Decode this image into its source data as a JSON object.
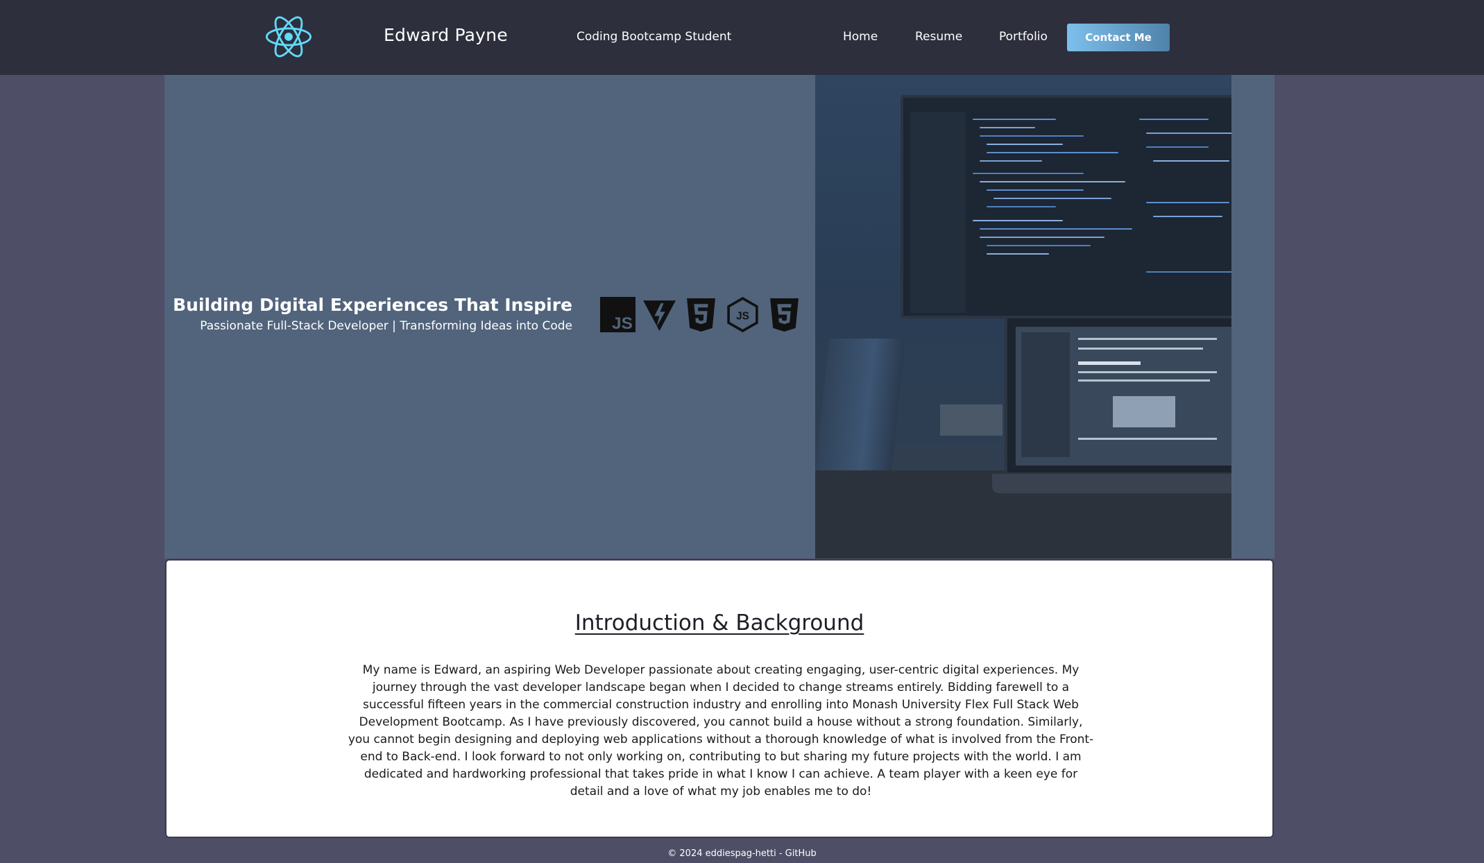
{
  "header": {
    "brand_name": "Edward Payne",
    "tagline": "Coding Bootcamp Student",
    "logo_icon": "react-atom-icon",
    "nav": [
      {
        "label": "Home"
      },
      {
        "label": "Resume"
      },
      {
        "label": "Portfolio"
      }
    ],
    "contact_label": "Contact Me"
  },
  "hero": {
    "title": "Building Digital Experiences That Inspire",
    "subtitle": "Passionate Full-Stack Developer | Transforming Ideas into Code",
    "tech_icons": [
      "javascript-icon",
      "vite-icon",
      "html5-icon",
      "nodejs-icon",
      "css3-icon"
    ],
    "tech_icon_labels": [
      "JS",
      "JS"
    ],
    "image": "desk-workstation-photo"
  },
  "intro": {
    "title": "Introduction & Background",
    "body": "My name is Edward, an aspiring Web Developer passionate about creating engaging, user-centric digital experiences. My journey through the vast developer landscape began when I decided to change streams entirely. Bidding farewell to a successful fifteen years in the commercial construction industry and enrolling into Monash University Flex Full Stack Web Development Bootcamp. As I have previously discovered, you cannot build a house without a strong foundation. Similarly, you cannot begin designing and deploying web applications without a thorough knowledge of what is involved from the Front-end to Back-end. I look forward to not only working on, contributing to but sharing my future projects with the world. I am dedicated and hardworking professional that takes pride in what I know I can achieve. A team player with a keen eye for detail and a love of what my job enables me to do!"
  },
  "footer": {
    "text": "© 2024 eddiespag-hetti - GitHub"
  },
  "colors": {
    "header_bg": "#2d2f3c",
    "page_bg": "#4f4e67",
    "hero_bg": "#51647c",
    "accent": "#61dafb",
    "button_start": "#7dc0ec",
    "button_end": "#4f82aa"
  }
}
